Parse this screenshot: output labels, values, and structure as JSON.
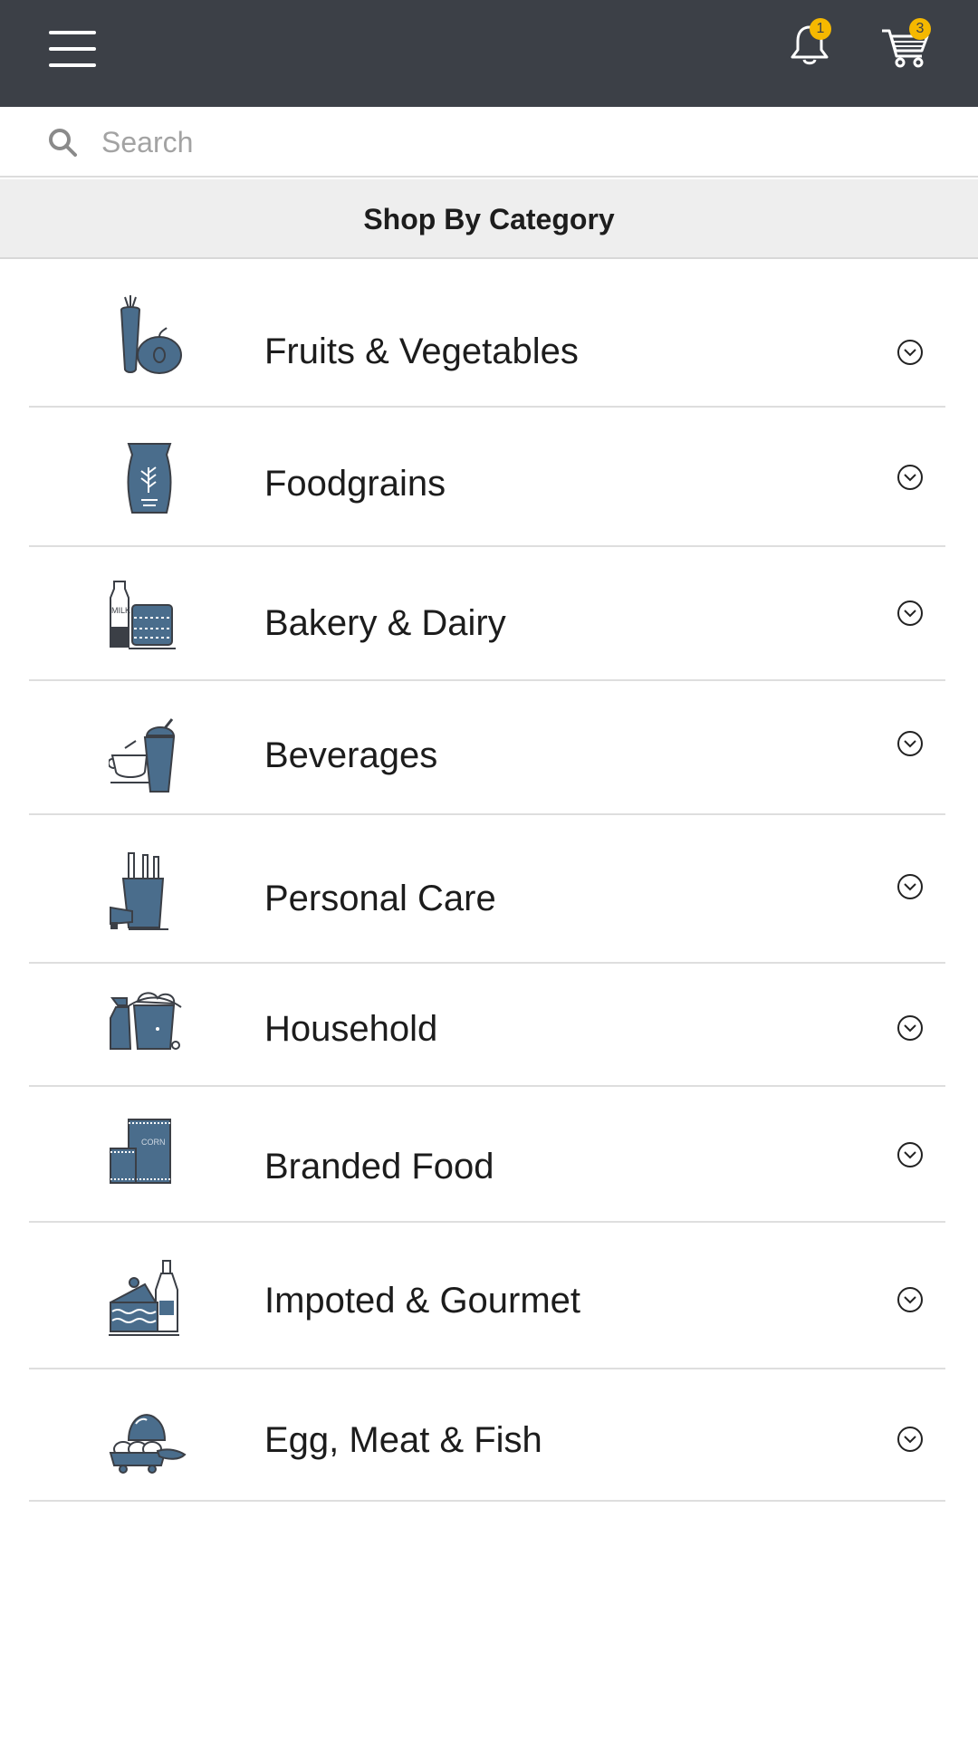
{
  "header": {
    "menu_icon": "hamburger-menu-icon",
    "notifications": {
      "icon": "bell-icon",
      "count": "1"
    },
    "cart": {
      "icon": "shopping-cart-icon",
      "count": "3"
    },
    "badge_color": "#f5b800",
    "bar_color": "#3c4047"
  },
  "search": {
    "placeholder": "Search",
    "value": "",
    "icon": "search-icon"
  },
  "section": {
    "title": "Shop By Category"
  },
  "accent_color": "#4a6d8c",
  "categories": [
    {
      "label": "Fruits & Vegetables",
      "icon": "fruits-vegetables-icon"
    },
    {
      "label": "Foodgrains",
      "icon": "foodgrains-sack-icon"
    },
    {
      "label": "Bakery & Dairy",
      "icon": "bakery-dairy-icon",
      "icon_text": "MILK"
    },
    {
      "label": "Beverages",
      "icon": "beverages-icon"
    },
    {
      "label": "Personal Care",
      "icon": "personal-care-icon"
    },
    {
      "label": "Household",
      "icon": "household-icon"
    },
    {
      "label": "Branded Food",
      "icon": "branded-food-icon",
      "icon_text": "CORN"
    },
    {
      "label": "Impoted & Gourmet",
      "icon": "imported-gourmet-icon"
    },
    {
      "label": "Egg, Meat & Fish",
      "icon": "egg-meat-fish-icon"
    }
  ]
}
